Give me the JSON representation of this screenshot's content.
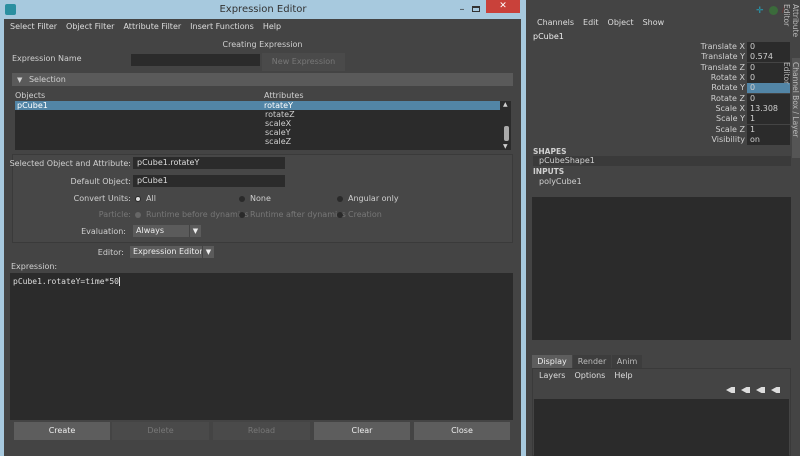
{
  "window": {
    "title": "Expression Editor",
    "controls": [
      "minimize",
      "maximize",
      "close"
    ]
  },
  "menu": [
    "Select Filter",
    "Object Filter",
    "Attribute Filter",
    "Insert Functions",
    "Help"
  ],
  "heading": "Creating Expression",
  "expression_name": {
    "label": "Expression Name",
    "value": "",
    "button": "New Expression"
  },
  "selection": {
    "header": "Selection",
    "objects_label": "Objects",
    "objects": [
      "pCube1"
    ],
    "attributes_label": "Attributes",
    "attributes": [
      "rotateY",
      "rotateZ",
      "scaleX",
      "scaleY",
      "scaleZ"
    ]
  },
  "form": {
    "selected_label": "Selected Object and Attribute:",
    "selected_value": "pCube1.rotateY",
    "default_label": "Default Object:",
    "default_value": "pCube1",
    "convert_label": "Convert Units:",
    "convert_options": [
      "All",
      "None",
      "Angular only"
    ],
    "convert_selected": "All",
    "particle_label": "Particle:",
    "particle_options": [
      "Runtime before dynamics",
      "Runtime after dynamics",
      "Creation"
    ],
    "evaluation_label": "Evaluation:",
    "evaluation_value": "Always",
    "editor_label": "Editor:",
    "editor_value": "Expression Editor"
  },
  "expression": {
    "label": "Expression:",
    "text": "pCube1.rotateY=time*50"
  },
  "buttons": {
    "create": "Create",
    "delete": "Delete",
    "reload": "Reload",
    "clear": "Clear",
    "close": "Close"
  },
  "channel_box": {
    "menu": [
      "Channels",
      "Edit",
      "Object",
      "Show"
    ],
    "object": "pCube1",
    "channels": [
      {
        "name": "Translate X",
        "value": "0"
      },
      {
        "name": "Translate Y",
        "value": "0.574"
      },
      {
        "name": "Translate Z",
        "value": "0"
      },
      {
        "name": "Rotate X",
        "value": "0"
      },
      {
        "name": "Rotate Y",
        "value": "0"
      },
      {
        "name": "Rotate Z",
        "value": "0"
      },
      {
        "name": "Scale X",
        "value": "13.308"
      },
      {
        "name": "Scale Y",
        "value": "1"
      },
      {
        "name": "Scale Z",
        "value": "1"
      },
      {
        "name": "Visibility",
        "value": "on"
      }
    ],
    "selected_channel": "Rotate Y",
    "shapes_label": "SHAPES",
    "shape": "pCubeShape1",
    "inputs_label": "INPUTS",
    "input": "polyCube1"
  },
  "side_tabs": [
    "Attribute Editor",
    "Channel Box / Layer Editor"
  ],
  "layer_editor": {
    "tabs": [
      "Display",
      "Render",
      "Anim"
    ],
    "active_tab": "Display",
    "menu": [
      "Layers",
      "Options",
      "Help"
    ]
  },
  "colors": {
    "selection": "#5285a6",
    "accent": "#24a0b8"
  }
}
